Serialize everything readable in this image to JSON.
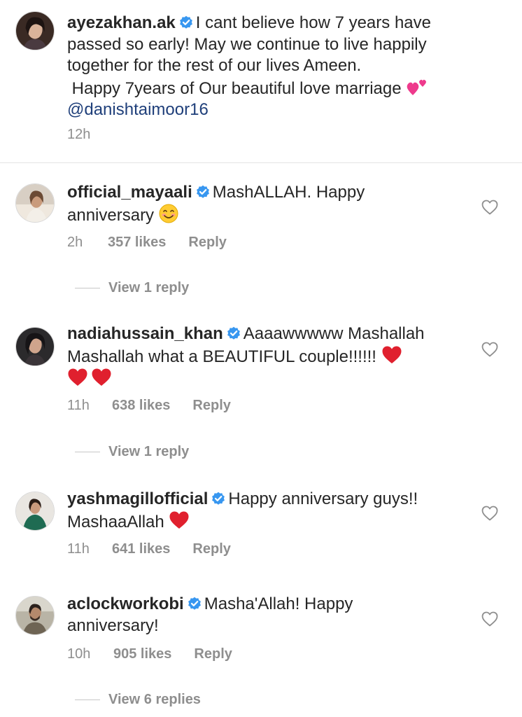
{
  "post": {
    "username": "ayezakhan.ak",
    "line1": "I cant believe how 7 years have",
    "line2": "passed so early! May we continue to live happily",
    "line3": "together for the rest of our lives Ameen.",
    "line4": " Happy 7years of Our beautiful love marriage",
    "mention": "@danishtaimoor16",
    "time": "12h",
    "emoji": "two-hearts-emoji"
  },
  "comments": [
    {
      "username": "official_mayaali",
      "text_a": "MashALLAH. Happy",
      "text_b": "anniversary",
      "emoji": "smiling-face-emoji",
      "time": "2h",
      "likes": "357 likes",
      "reply": "Reply",
      "view_replies": "View 1 reply"
    },
    {
      "username": "nadiahussain_khan",
      "text_a": "Aaaawwwww Mashallah",
      "text_b": "Mashallah what a BEAUTIFUL couple!!!!!!",
      "emoji": "red-heart-emoji",
      "time": "11h",
      "likes": "638 likes",
      "reply": "Reply",
      "view_replies": "View 1 reply"
    },
    {
      "username": "yashmagillofficial",
      "text_a": "Happy anniversary guys!!",
      "text_b": "MashaaAllah",
      "emoji": "red-heart-emoji",
      "time": "11h",
      "likes": "641 likes",
      "reply": "Reply"
    },
    {
      "username": "aclockworkobi",
      "text_a": "Masha'Allah! Happy",
      "text_b": "anniversary!",
      "time": "10h",
      "likes": "905 likes",
      "reply": "Reply",
      "view_replies": "View 6 replies"
    }
  ],
  "colors": {
    "text": "#262626",
    "secondary": "#8e8e8e",
    "verified": "#3897f0",
    "mention": "#1f3f7a",
    "heart_emoji": "#e0202e"
  },
  "icons": {
    "verified": "verified-badge-icon",
    "like": "heart-outline-icon"
  }
}
